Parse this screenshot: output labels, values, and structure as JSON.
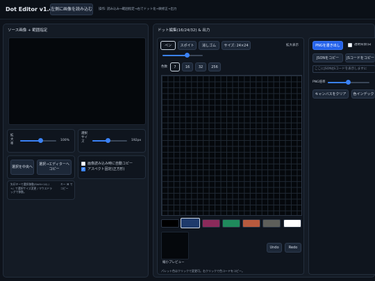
{
  "app": {
    "title": "Dot Editor v1.4.1",
    "load_button": "左側に画像を読み込む",
    "instructions": "操作: 読み込み→範囲指定→右でドット化→微修正→出力"
  },
  "source_panel": {
    "title": "ソース画像 + 範囲指定",
    "zoom_label": "拡大率",
    "zoom_value": "100%",
    "zoom_level": 0.55,
    "select_size_label": "選択サイズ",
    "select_size_value": "192px",
    "select_size_level": 0.45,
    "fit_button": "選択を中央へ",
    "copy_to_editor_button": "選択→エディターへコピー",
    "auto_copy_label": "画像読み込み時に自動コピー",
    "auto_copy_checked": false,
    "aspect_label": "アスペクト固定(正方形)",
    "aspect_checked": true,
    "keys_help": "矢印キーで選択移動(Shift+10) / +/- で選択サイズ変更 / マウスドラッグで移動。",
    "key_hint": "キー ⌘ でコピー"
  },
  "dot_panel": {
    "title": "ドット編集(16/24/32) & 出力",
    "tools": {
      "pen": "ペン",
      "eyedropper": "スポイト",
      "eraser": "消しゴム",
      "size": "サイズ: 24×24"
    },
    "brush_level": 0.6,
    "zoom_display": "拡大表示",
    "res_label": "色数",
    "res_options": [
      "7",
      "16",
      "32",
      "256"
    ],
    "res_selected": "7",
    "palette": [
      "#000000",
      "#1e3a6b",
      "#8b2a5a",
      "#1f8a5c",
      "#b85a3e",
      "#5e5f5a",
      "#ffffff"
    ],
    "palette_selected": 1,
    "preview_label": "縮小プレビュー",
    "undo": "Undo",
    "redo": "Redo",
    "palette_hint": "パレット色はクリックで変更可。右クリックで色コードをコピー。"
  },
  "output": {
    "png_button": "PNGを書き出し",
    "transparent_label": "透明背景(白",
    "transparent_checked": false,
    "json_button": "JSONをコピー",
    "jscode_button": "JSコードをコピー",
    "textarea_placeholder": "ここにJSON/JSコードを表示しますに",
    "png_scale_label": "PNG倍率",
    "png_scale_level": 0.5,
    "clear_button": "キャンバスをクリア",
    "color_index_button": "色インデック"
  }
}
